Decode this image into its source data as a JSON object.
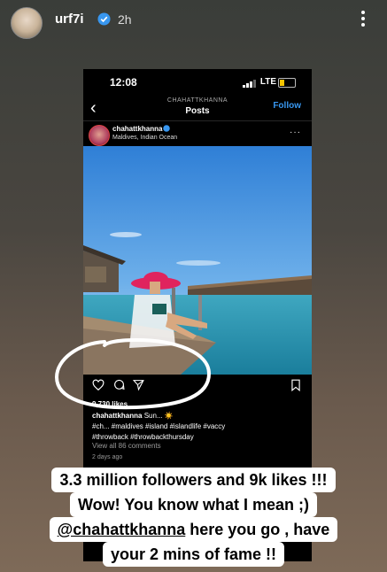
{
  "story": {
    "username": "urf7i",
    "time": "2h"
  },
  "phone": {
    "clock": "12:08",
    "network": "LTE",
    "nav_account": "CHAHATTKHANNA",
    "nav_title": "Posts",
    "follow_label": "Follow",
    "post": {
      "user": "chahattkhanna",
      "location": "Maldives, Indian Ocean",
      "likes": "9,730 likes",
      "caption_user": "chahattkhanna",
      "caption_line1": "Sun... ☀️",
      "caption_line2": "#ch... #maldives #island #islandlife #vaccy",
      "caption_line3": "#throwback #throwbackthursday",
      "comments": "View all 86 comments",
      "date": "2 days ago"
    }
  },
  "overlay": {
    "line1": "3.3 million followers and 9k likes !!!",
    "line2": "Wow! You know what I mean ;)",
    "line3_mention": "@chahattkhanna",
    "line3_rest": " here you go , have",
    "line4": "your 2 mins of fame !!"
  },
  "colors": {
    "accent": "#3897f0",
    "verified": "#3897f0",
    "hat": "#e0245e"
  },
  "icons": [
    "verified-icon",
    "more-icon",
    "back-icon",
    "heart-icon",
    "comment-icon",
    "share-icon",
    "bookmark-icon"
  ]
}
